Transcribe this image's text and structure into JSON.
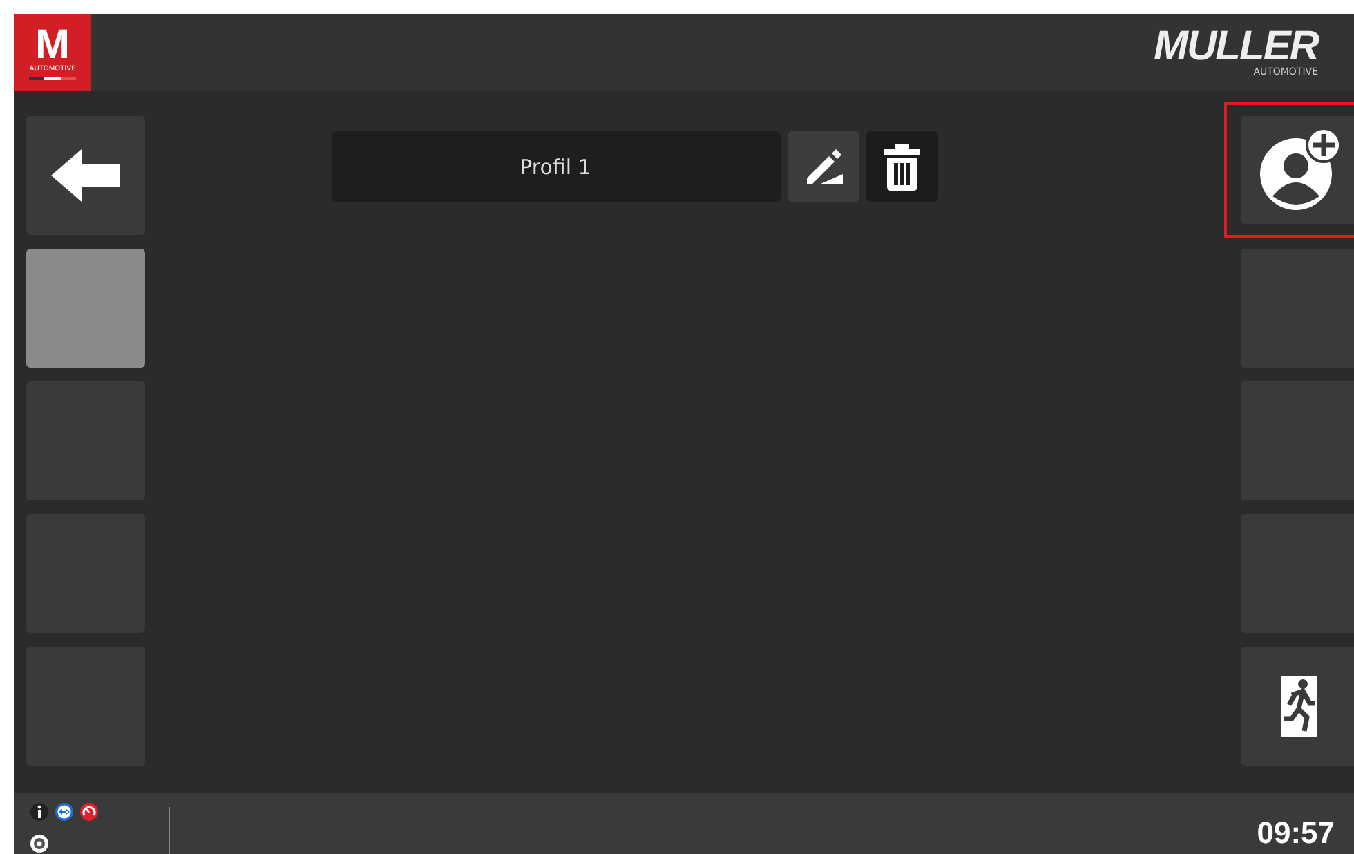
{
  "header": {
    "app_logo": {
      "letter": "M",
      "caption": "AUTOMOTIVE"
    },
    "brand_logo": {
      "name": "MULLER",
      "caption": "AUTOMOTIVE"
    }
  },
  "profile": {
    "name": "Profil 1"
  },
  "left_buttons": [
    {
      "kind": "back",
      "selected": false
    },
    {
      "kind": "empty",
      "selected": true
    },
    {
      "kind": "empty",
      "selected": false
    },
    {
      "kind": "empty",
      "selected": false
    },
    {
      "kind": "empty",
      "selected": false
    }
  ],
  "right_buttons": [
    {
      "kind": "add_user",
      "highlighted": true
    },
    {
      "kind": "empty",
      "highlighted": false
    },
    {
      "kind": "empty",
      "highlighted": false
    },
    {
      "kind": "empty",
      "highlighted": false
    },
    {
      "kind": "exit",
      "highlighted": false
    }
  ],
  "status_bar": {
    "time": "09:57"
  }
}
